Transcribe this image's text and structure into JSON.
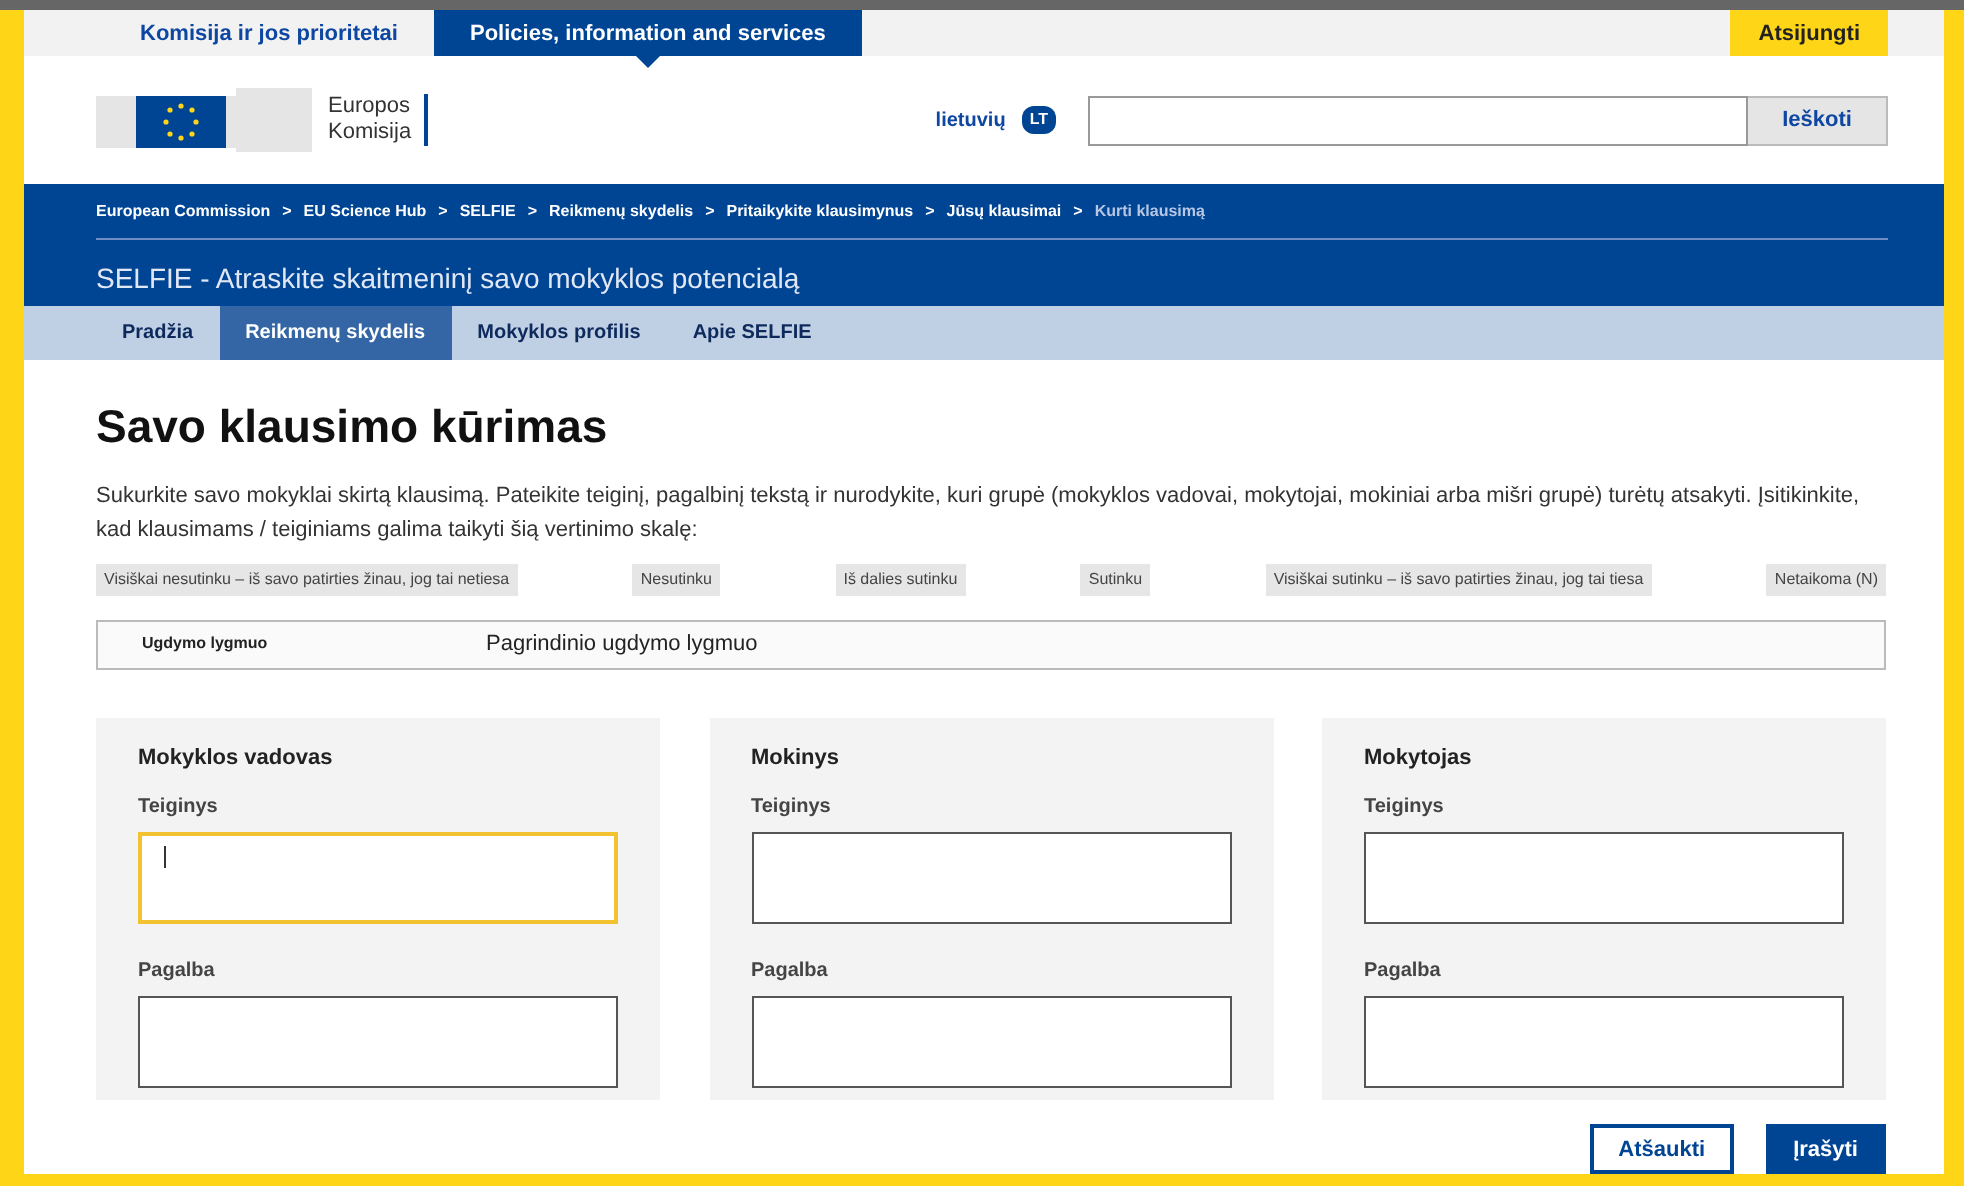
{
  "top_tabs": [
    {
      "label": "Komisija ir jos prioritetai",
      "selected": false
    },
    {
      "label": "Policies, information and services",
      "selected": true
    }
  ],
  "logout": "Atsijungti",
  "logo": {
    "line1": "Europos",
    "line2": "Komisija"
  },
  "language": {
    "label": "lietuvių",
    "code": "LT"
  },
  "search": {
    "button": "Ieškoti"
  },
  "breadcrumb": [
    {
      "label": "European Commission",
      "current": false
    },
    {
      "label": "EU Science Hub",
      "current": false
    },
    {
      "label": "SELFIE",
      "current": false
    },
    {
      "label": "Reikmenų skydelis",
      "current": false
    },
    {
      "label": "Pritaikykite klausimynus",
      "current": false
    },
    {
      "label": "Jūsų klausimai",
      "current": false
    },
    {
      "label": "Kurti klausimą",
      "current": true
    }
  ],
  "breadcrumb_separator": ">",
  "site_title": "SELFIE - Atraskite skaitmeninį savo mokyklos potencialą",
  "nav": [
    {
      "label": "Pradžia",
      "selected": false
    },
    {
      "label": "Reikmenų skydelis",
      "selected": true
    },
    {
      "label": "Mokyklos profilis",
      "selected": false
    },
    {
      "label": "Apie SELFIE",
      "selected": false
    }
  ],
  "heading": "Savo klausimo kūrimas",
  "intro": "Sukurkite savo mokyklai skirtą klausimą. Pateikite teiginį, pagalbinį tekstą ir nurodykite, kuri grupė (mokyklos vadovai, mokytojai, mokiniai arba mišri grupė) turėtų atsakyti. Įsitikinkite, kad klausimams / teiginiams galima taikyti šią vertinimo skalę:",
  "scale": [
    "Visiškai nesutinku – iš savo patirties žinau, jog tai netiesa",
    "Nesutinku",
    "Iš dalies sutinku",
    "Sutinku",
    "Visiškai sutinku – iš savo patirties žinau, jog tai tiesa",
    "Netaikoma (N)"
  ],
  "level_row": {
    "label": "Ugdymo lygmuo",
    "value": "Pagrindinio ugdymo lygmuo"
  },
  "groups": [
    {
      "title": "Mokyklos vadovas",
      "fields": [
        {
          "label": "Teiginys",
          "focused": true
        },
        {
          "label": "Pagalba",
          "focused": false
        }
      ]
    },
    {
      "title": "Mokinys",
      "fields": [
        {
          "label": "Teiginys",
          "focused": false
        },
        {
          "label": "Pagalba",
          "focused": false
        }
      ]
    },
    {
      "title": "Mokytojas",
      "fields": [
        {
          "label": "Teiginys",
          "focused": false
        },
        {
          "label": "Pagalba",
          "focused": false
        }
      ]
    }
  ],
  "buttons": [
    {
      "label": "Atšaukti",
      "kind": "secondary"
    },
    {
      "label": "Įrašyti",
      "kind": "primary"
    }
  ]
}
